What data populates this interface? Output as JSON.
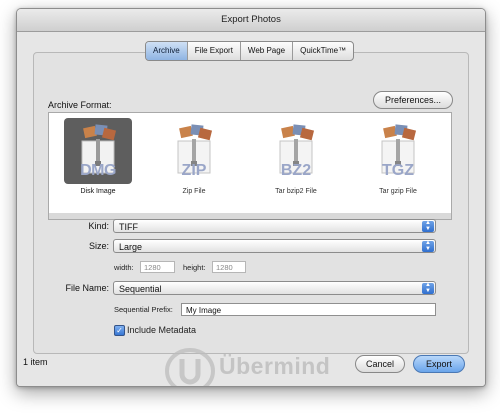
{
  "window": {
    "title": "Export Photos"
  },
  "tabs": [
    {
      "label": "Archive",
      "selected": true
    },
    {
      "label": "File Export",
      "selected": false
    },
    {
      "label": "Web Page",
      "selected": false
    },
    {
      "label": "QuickTime™",
      "selected": false
    }
  ],
  "archive": {
    "label": "Archive Format:",
    "preferences_label": "Preferences...",
    "formats": [
      {
        "badge": "DMG",
        "caption": "Disk Image",
        "selected": true
      },
      {
        "badge": "ZIP",
        "caption": "Zip File",
        "selected": false
      },
      {
        "badge": "BZ2",
        "caption": "Tar bzip2 File",
        "selected": false
      },
      {
        "badge": "TGZ",
        "caption": "Tar gzip File",
        "selected": false
      }
    ]
  },
  "options": {
    "kind_label": "Kind:",
    "kind_value": "TIFF",
    "size_label": "Size:",
    "size_value": "Large",
    "width_label": "width:",
    "width_value": "1280",
    "height_label": "height:",
    "height_value": "1280",
    "filename_label": "File Name:",
    "filename_value": "Sequential",
    "prefix_label": "Sequential Prefix:",
    "prefix_value": "My Image",
    "metadata_label": "Include Metadata",
    "metadata_checked": true
  },
  "footer": {
    "count": "1 item",
    "cancel_label": "Cancel",
    "export_label": "Export"
  },
  "watermark": {
    "text": "Übermind"
  },
  "colors": {
    "accent": "#3776d3",
    "tab_selected": "#8fb4e3",
    "badge": "#9aa6c8"
  }
}
